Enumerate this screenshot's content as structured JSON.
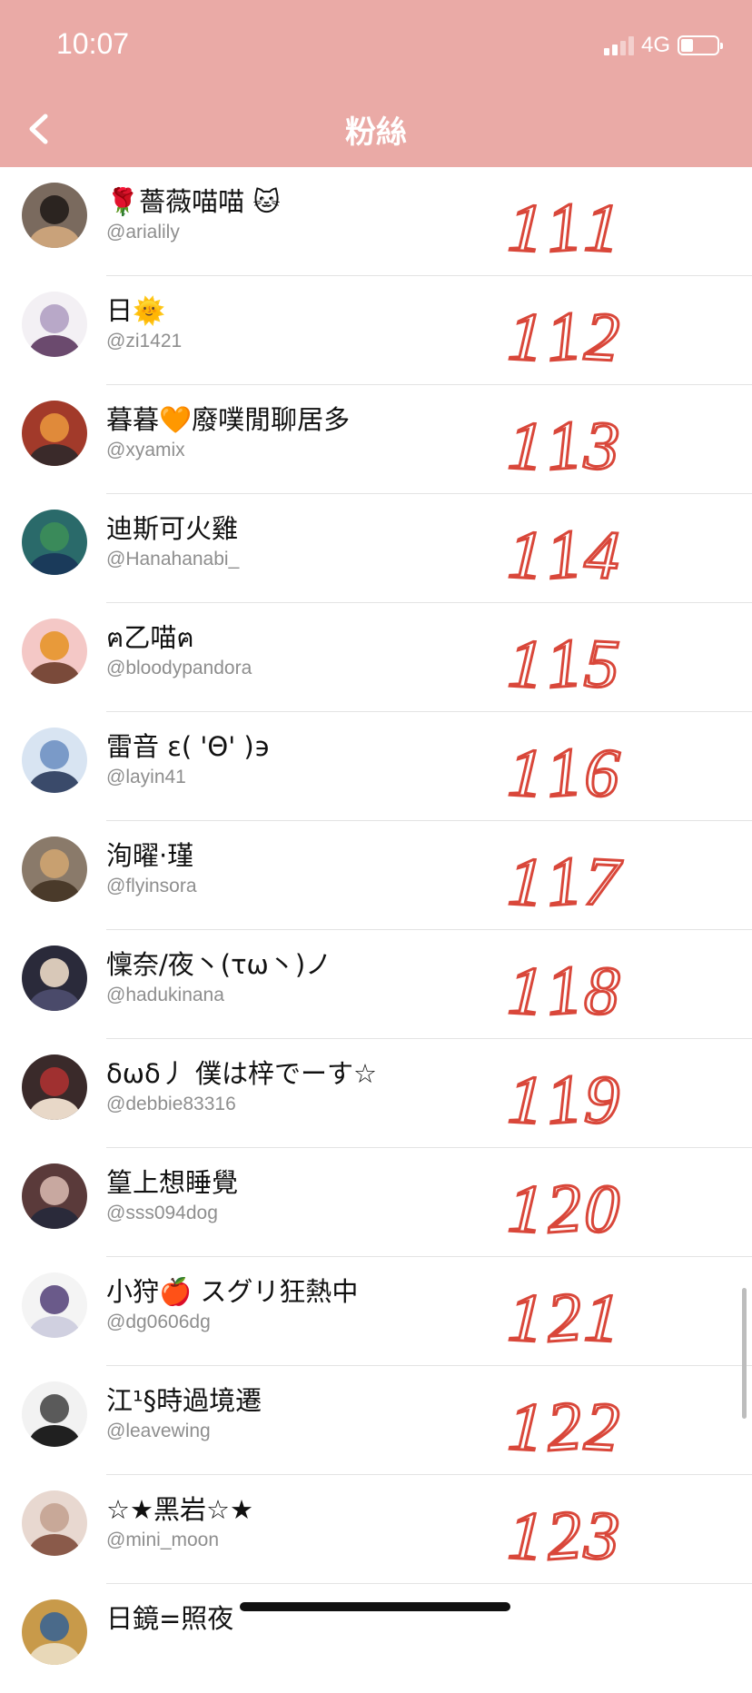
{
  "status_bar": {
    "time": "10:07",
    "network": "4G",
    "battery_level": 0.35
  },
  "header": {
    "title": "粉絲",
    "background_color": "#eaaaa6",
    "back_icon": "chevron-left-icon"
  },
  "followers": [
    {
      "name": "🌹薔薇喵喵 🐱",
      "handle": "@arialily",
      "avatar_icon": "cat-photo-avatar",
      "annotation": "111"
    },
    {
      "name": "日🌞",
      "handle": "@zi1421",
      "avatar_icon": "anime-character-avatar",
      "annotation": "112"
    },
    {
      "name": "暮暮🧡廢噗閒聊居多",
      "handle": "@xyamix",
      "avatar_icon": "anime-character-avatar",
      "annotation": "113"
    },
    {
      "name": "迪斯可火雞",
      "handle": "@Hanahanabi_",
      "avatar_icon": "peacock-photo-avatar",
      "annotation": "114"
    },
    {
      "name": "ฅ乙喵ฅ",
      "handle": "@bloodypandora",
      "avatar_icon": "pixel-art-avatar",
      "annotation": "115"
    },
    {
      "name": "雷音 ɛ( 'Θ' )϶",
      "handle": "@layin41",
      "avatar_icon": "anime-character-avatar",
      "annotation": "116"
    },
    {
      "name": "洵曜·瑾",
      "handle": "@flyinsora",
      "avatar_icon": "cat-photo-avatar",
      "annotation": "117"
    },
    {
      "name": "懍奈/夜丶(τω丶)ノ",
      "handle": "@hadukinana",
      "avatar_icon": "anime-character-avatar",
      "annotation": "118"
    },
    {
      "name": "δωδ丿 僕は梓でーす☆",
      "handle": "@debbie83316",
      "avatar_icon": "anime-character-avatar",
      "annotation": "119"
    },
    {
      "name": "篁上想睡覺",
      "handle": "@sss094dog",
      "avatar_icon": "anime-character-avatar",
      "annotation": "120"
    },
    {
      "name": "小狩🍎 スグリ狂熱中",
      "handle": "@dg0606dg",
      "avatar_icon": "wolf-sketch-avatar",
      "annotation": "121"
    },
    {
      "name": "江¹§時過境遷",
      "handle": "@leavewing",
      "avatar_icon": "anime-character-avatar",
      "annotation": "122"
    },
    {
      "name": "☆★黑岩☆★",
      "handle": "@mini_moon",
      "avatar_icon": "plush-doll-avatar",
      "annotation": "123"
    },
    {
      "name": "日鏡=照夜",
      "handle": "",
      "avatar_icon": "anime-character-avatar",
      "annotation": ""
    }
  ],
  "annotation_color": "#d9473a",
  "scroll_position": 0.83
}
